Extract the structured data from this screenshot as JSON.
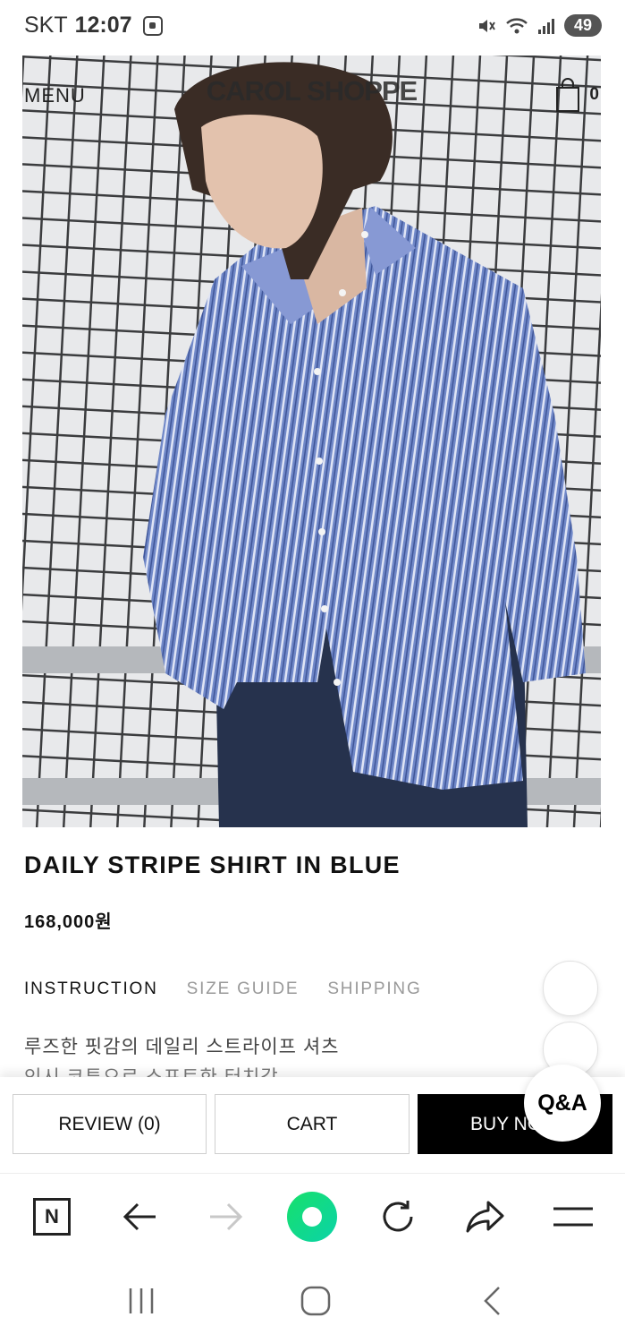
{
  "status_bar": {
    "carrier": "SKT",
    "time": "12:07",
    "battery": "49"
  },
  "header": {
    "menu_label": "MENU",
    "brand": "CAROL SHOPPE",
    "cart_count": "0"
  },
  "product": {
    "title": "DAILY STRIPE SHIRT IN BLUE",
    "price": "168,000원",
    "description_line1": "루즈한 핏감의 데일리 스트라이프 셔츠",
    "description_line2": "인시 코투으로 스프트한 터치감"
  },
  "tabs": [
    {
      "label": "INSTRUCTION",
      "active": true
    },
    {
      "label": "SIZE GUIDE",
      "active": false
    },
    {
      "label": "SHIPPING",
      "active": false
    }
  ],
  "actions": {
    "review_label": "REVIEW (0)",
    "cart_label": "CART",
    "buy_label": "BUY NOW",
    "qa_label": "Q&A"
  },
  "browser_nav": {
    "home_label": "N"
  },
  "colors": {
    "buy_button_bg": "#000000",
    "accent_green": "#17e06b",
    "shirt_blue": "#6f83c4"
  }
}
